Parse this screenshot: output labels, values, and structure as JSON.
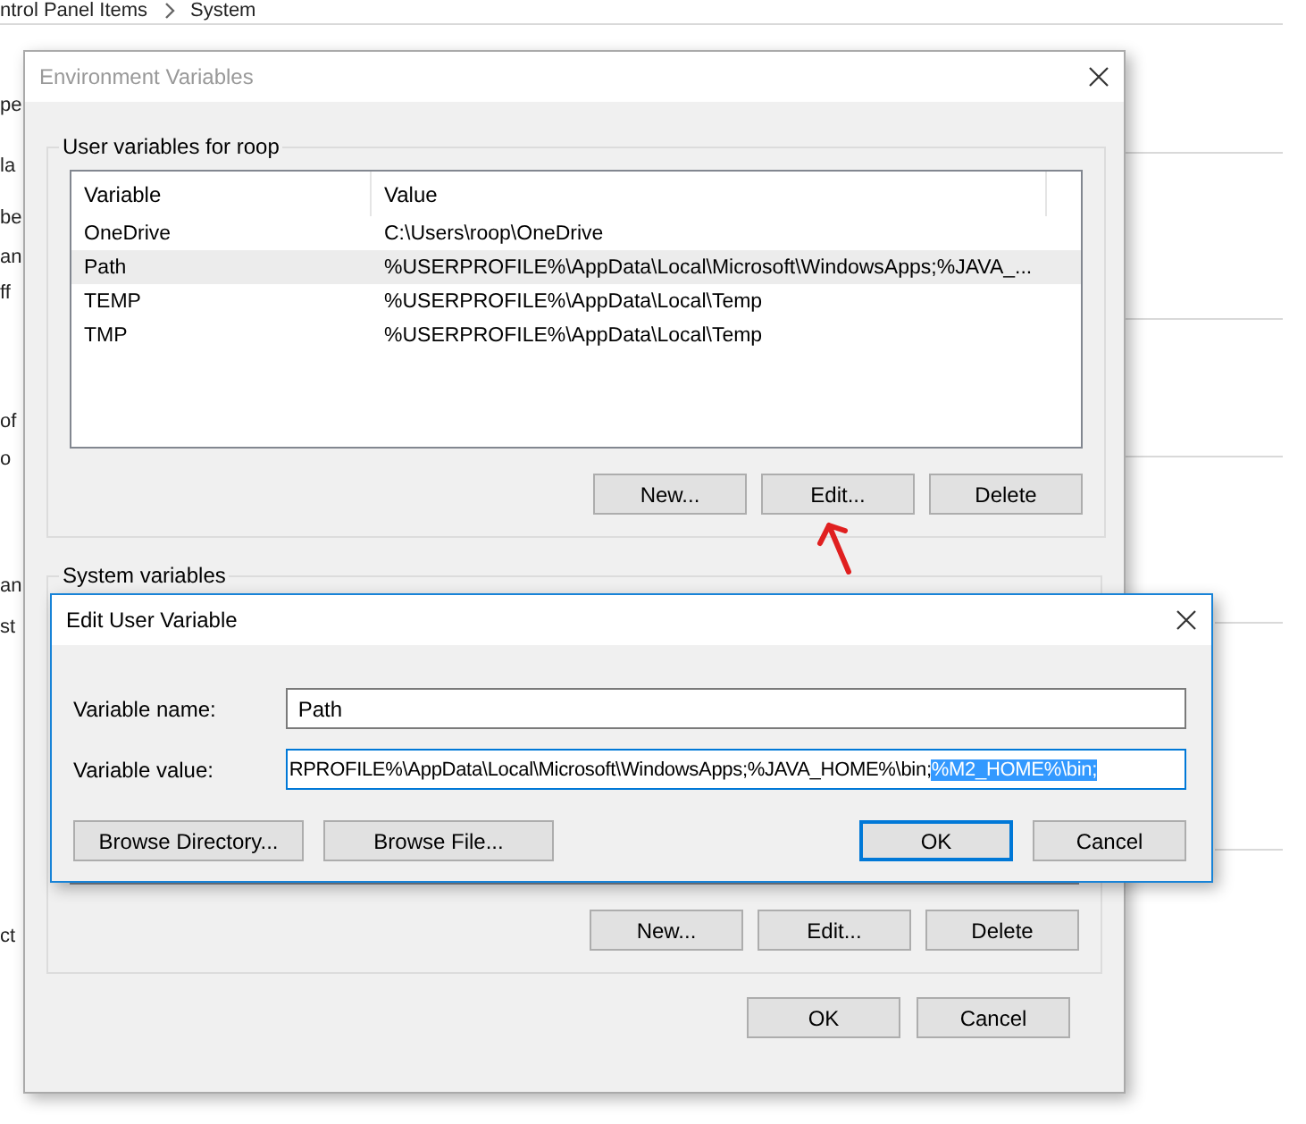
{
  "breadcrumb": {
    "items": [
      "ntrol Panel Items",
      "System"
    ]
  },
  "background_fragments": [
    "pe",
    "la",
    "be",
    "an",
    "ff",
    "of",
    "o",
    "an",
    "st",
    "ct"
  ],
  "env_window": {
    "title": "Environment Variables",
    "active": false,
    "user_group": {
      "label": "User variables for roop",
      "columns": [
        "Variable",
        "Value"
      ],
      "rows": [
        {
          "variable": "OneDrive",
          "value": "C:\\Users\\roop\\OneDrive",
          "selected": false
        },
        {
          "variable": "Path",
          "value": "%USERPROFILE%\\AppData\\Local\\Microsoft\\WindowsApps;%JAVA_...",
          "selected": true
        },
        {
          "variable": "TEMP",
          "value": "%USERPROFILE%\\AppData\\Local\\Temp",
          "selected": false
        },
        {
          "variable": "TMP",
          "value": "%USERPROFILE%\\AppData\\Local\\Temp",
          "selected": false
        }
      ],
      "buttons": [
        "New...",
        "Edit...",
        "Delete"
      ]
    },
    "system_group": {
      "label": "System variables",
      "buttons": [
        "New...",
        "Edit...",
        "Delete"
      ]
    },
    "buttons": [
      "OK",
      "Cancel"
    ]
  },
  "edit_dialog": {
    "title": "Edit User Variable",
    "active": true,
    "fields": [
      {
        "label": "Variable name:",
        "value": "Path",
        "focused": false
      },
      {
        "label": "Variable value:",
        "value": "RPROFILE%\\AppData\\Local\\Microsoft\\WindowsApps;%JAVA_HOME%\\bin;",
        "selected_text": "%M2_HOME%\\bin;",
        "focused": true
      }
    ],
    "buttons": [
      {
        "label": "Browse Directory...",
        "default": false
      },
      {
        "label": "Browse File...",
        "default": false
      },
      {
        "label": "OK",
        "default": true
      },
      {
        "label": "Cancel",
        "default": false
      }
    ]
  }
}
